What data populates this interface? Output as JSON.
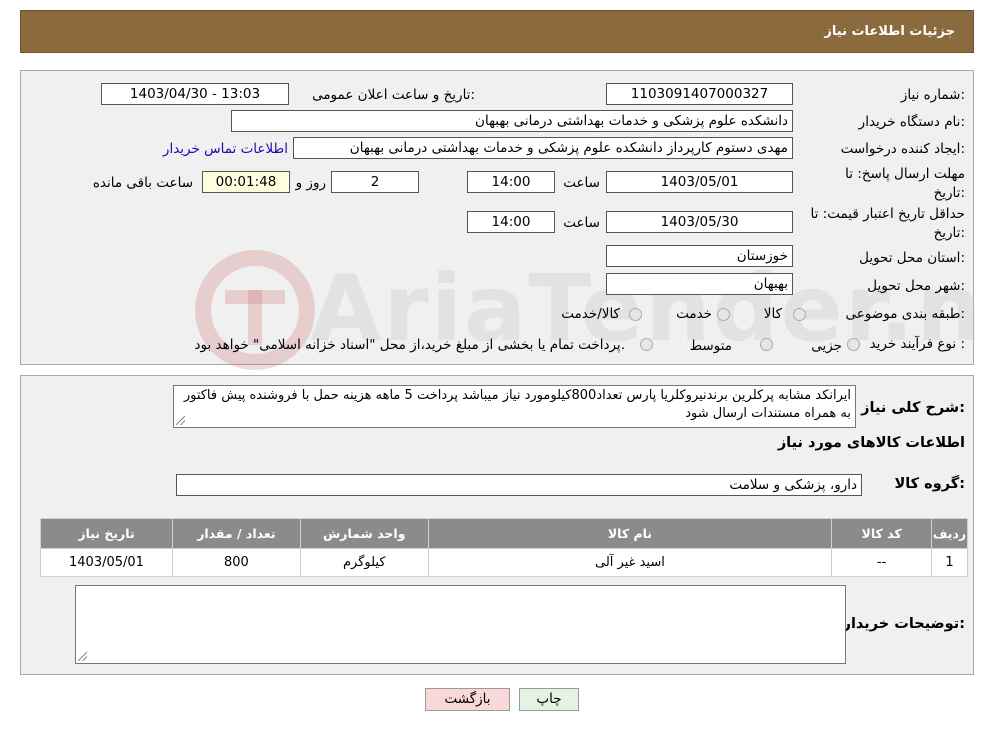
{
  "header": {
    "title": "جزئیات اطلاعات نیاز"
  },
  "form": {
    "need_number_label": "شماره نیاز:",
    "need_number": "1103091407000327",
    "announce_label": "تاریخ و ساعت اعلان عمومی:",
    "announce_value": "1403/04/30 - 13:03",
    "buyer_org_label": "نام دستگاه خریدار:",
    "buyer_org": "دانشکده علوم پزشکی و خدمات بهداشتی  درمانی بهبهان",
    "creator_label": "ایجاد کننده درخواست:",
    "creator": "مهدی دستوم کارپرداز دانشکده علوم پزشکی و خدمات بهداشتی  درمانی بهبهان",
    "contact_link": "اطلاعات تماس خریدار",
    "deadline_label": "مهلت ارسال پاسخ: تا تاریخ:",
    "deadline_date": "1403/05/01",
    "time_label": "ساعت",
    "deadline_time": "14:00",
    "days_value": "2",
    "days_label": "روز و",
    "remaining_time": "00:01:48",
    "remaining_label": "ساعت باقی مانده",
    "validity_label": "حداقل تاریخ اعتبار قیمت: تا تاریخ:",
    "validity_date": "1403/05/30",
    "validity_time": "14:00",
    "province_label": "استان محل تحویل:",
    "province": "خوزستان",
    "city_label": "شهر محل تحویل:",
    "city": "بهبهان",
    "category_label": "طبقه بندی موضوعی:",
    "category_options": [
      "کالا",
      "خدمت",
      "کالا/خدمت"
    ],
    "process_label": "نوع فرآیند خرید :",
    "process_options": [
      "جزیی",
      "متوسط"
    ],
    "process_note": "پرداخت تمام یا بخشی از مبلغ خرید،از محل \"اسناد خزانه اسلامی\" خواهد بود."
  },
  "description": {
    "label": "شرح کلی نیاز:",
    "text": "ایرانکد مشابه پرکلرین برندنیروکلریا پارس تعداد800کیلومورد نیاز میباشد پرداخت 5 ماهه هزینه حمل با فروشنده پیش فاکتور به همراه مستندات ارسال شود"
  },
  "goods": {
    "section_title": "اطلاعات کالاهای مورد نیاز",
    "group_label": "گروه کالا:",
    "group_value": "دارو، پزشکی و سلامت",
    "columns": [
      "ردیف",
      "کد کالا",
      "نام کالا",
      "واحد شمارش",
      "تعداد / مقدار",
      "تاریخ نیاز"
    ],
    "rows": [
      [
        "1",
        "--",
        "اسید غیر آلی",
        "کیلوگرم",
        "800",
        "1403/05/01"
      ]
    ]
  },
  "buyer_notes": {
    "label": "توضیحات خریدار:",
    "value": ""
  },
  "buttons": {
    "print": "چاپ",
    "back": "بازگشت"
  },
  "watermark": {
    "text": "AriaTender.neT"
  },
  "colors": {
    "header": "#8b6b3d",
    "table_header": "#8b8b8b",
    "link": "#1a0dab",
    "back_button": "#f8d8d8",
    "print_button": "#e4f4e4"
  }
}
